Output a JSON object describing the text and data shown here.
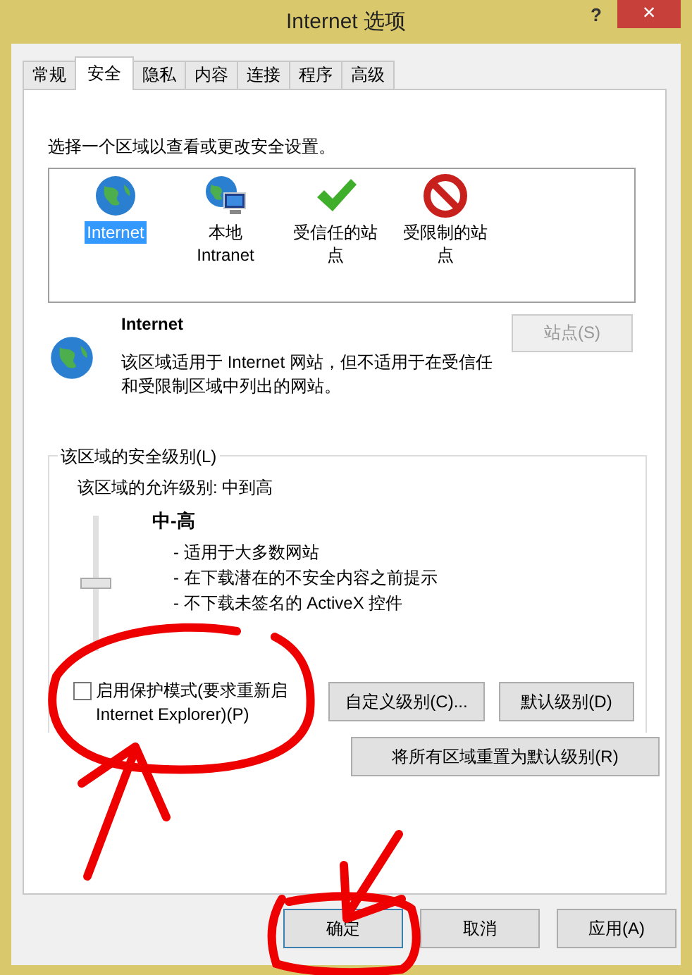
{
  "window": {
    "title": "Internet 选项",
    "help": "?",
    "close": "×"
  },
  "tabs": [
    {
      "label": "常规",
      "selected": false
    },
    {
      "label": "安全",
      "selected": true
    },
    {
      "label": "隐私",
      "selected": false
    },
    {
      "label": "内容",
      "selected": false
    },
    {
      "label": "连接",
      "selected": false
    },
    {
      "label": "程序",
      "selected": false
    },
    {
      "label": "高级",
      "selected": false
    }
  ],
  "zone_prompt": "选择一个区域以查看或更改安全设置。",
  "zones": [
    {
      "kind": "globe",
      "label": "Internet",
      "selected": true
    },
    {
      "kind": "intranet",
      "label": "本地 Intranet",
      "selected": false
    },
    {
      "kind": "trusted",
      "label": "受信任的站点",
      "selected": false
    },
    {
      "kind": "restricted",
      "label": "受限制的站点",
      "selected": false
    }
  ],
  "zone_info": {
    "name": "Internet",
    "description": "该区域适用于 Internet 网站，但不适用于在受信任和受限制区域中列出的网站。",
    "sites_button": {
      "label": "站点(S)",
      "disabled": true
    }
  },
  "security_level": {
    "group_label": "该区域的安全级别(L)",
    "allowed": "该区域的允许级别: 中到高",
    "level_name": "中-高",
    "level": 0.5,
    "bullets": [
      "- 适用于大多数网站",
      "- 在下载潜在的不安全内容之前提示",
      "- 不下载未签名的 ActiveX 控件"
    ]
  },
  "protected_mode": {
    "label": "启用保护模式(要求重新启Internet Explorer)(P)",
    "checked": false
  },
  "level_buttons": [
    {
      "label": "自定义级别(C)..."
    },
    {
      "label": "默认级别(D)"
    }
  ],
  "reset_button": {
    "label": "将所有区域重置为默认级别(R)"
  },
  "dialog_buttons": [
    {
      "label": "确定",
      "default": true
    },
    {
      "label": "取消",
      "default": false
    },
    {
      "label": "应用(A)",
      "default": false
    }
  ]
}
